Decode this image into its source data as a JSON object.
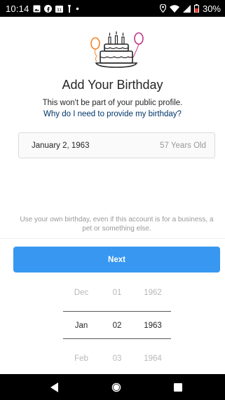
{
  "status_bar": {
    "time": "10:14",
    "battery": "30%",
    "icons": [
      "image-icon",
      "facebook-icon",
      "calendar-icon",
      "flashlight-icon",
      "dot-icon",
      "location-icon",
      "wifi-icon",
      "signal-icon",
      "battery-icon"
    ],
    "calendar_badge": "31"
  },
  "header": {
    "illustration": "birthday-cake-balloons",
    "title": "Add Your Birthday",
    "subtitle": "This won't be part of your public profile.",
    "why_link": "Why do I need to provide my birthday?"
  },
  "birthday_field": {
    "date": "January 2, 1963",
    "age": "57 Years Old"
  },
  "hint": "Use your own birthday, even if this account is for a business, a pet or something else.",
  "next_button": "Next",
  "picker": {
    "month": [
      "Dec",
      "Jan",
      "Feb"
    ],
    "day": [
      "01",
      "02",
      "03"
    ],
    "year": [
      "1962",
      "1963",
      "1964"
    ],
    "selected_index": 1
  },
  "nav_bar": {
    "icons": [
      "back-icon",
      "home-icon",
      "recents-icon"
    ]
  },
  "colors": {
    "accent": "#3897f0",
    "link": "#003569",
    "muted": "#999999"
  }
}
